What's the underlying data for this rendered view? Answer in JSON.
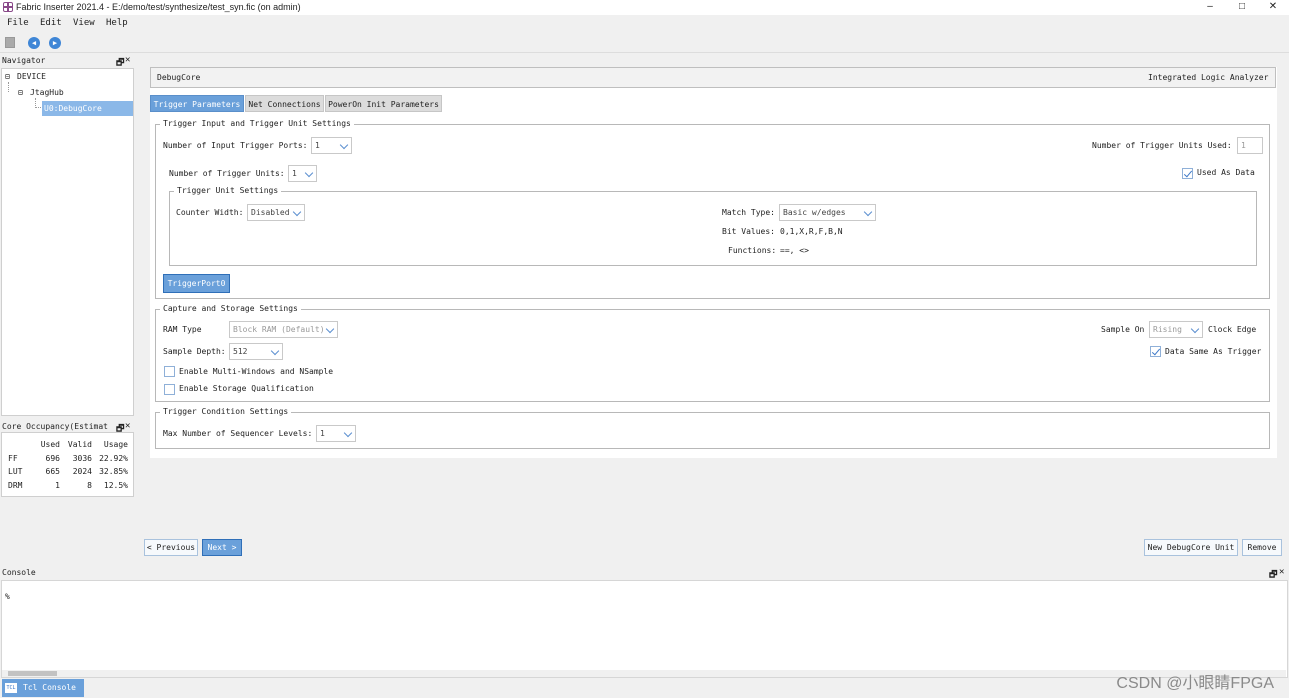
{
  "window": {
    "title": "Fabric Inserter 2021.4 - E:/demo/test/synthesize/test_syn.fic (on admin)",
    "minimize": "–",
    "maximize": "□",
    "close": "✕"
  },
  "menu": {
    "file": "File",
    "edit": "Edit",
    "view": "View",
    "help": "Help"
  },
  "toolbar": {
    "icons": [
      "save-icon",
      "back-icon",
      "forward-icon"
    ]
  },
  "navigator": {
    "title": "Navigator",
    "tree": [
      {
        "label": "DEVICE",
        "toggle": "⊟"
      },
      {
        "label": "JtagHub",
        "toggle": "⊟"
      },
      {
        "label": "U0:DebugCore",
        "selected": true
      }
    ]
  },
  "occupancy": {
    "title": "Core Occupancy(Estimat",
    "headers": [
      "",
      "Used",
      "Valid",
      "Usage"
    ],
    "rows": [
      [
        "FF",
        "696",
        "3036",
        "22.92%"
      ],
      [
        "LUT",
        "665",
        "2024",
        "32.85%"
      ],
      [
        "DRM",
        "1",
        "8",
        "12.5%"
      ]
    ]
  },
  "core_header": {
    "name": "DebugCore",
    "type": "Integrated Logic Analyzer"
  },
  "tabs": [
    "Trigger Parameters",
    "Net Connections",
    "PowerOn Init Parameters"
  ],
  "trigger_input": {
    "group": "Trigger Input and Trigger Unit Settings",
    "num_ports_label": "Number of Input Trigger Ports:",
    "num_ports": "1",
    "units_used_label": "Number of Trigger Units Used:",
    "units_used": "1",
    "num_units_label": "Number of Trigger Units:",
    "num_units": "1",
    "used_as_data": "Used As Data",
    "unit_group": "Trigger Unit Settings",
    "counter_width_label": "Counter Width:",
    "counter_width": "Disabled",
    "match_type_label": "Match Type:",
    "match_type": "Basic w/edges",
    "bit_values_label": "Bit Values:",
    "bit_values": "0,1,X,R,F,B,N",
    "functions_label": "Functions:",
    "functions": "==, <>",
    "port_button": "TriggerPort0"
  },
  "capture": {
    "group": "Capture and Storage Settings",
    "ram_type_label": "RAM Type",
    "ram_type": "Block RAM (Default)",
    "sample_on_label": "Sample On",
    "sample_on": "Rising",
    "clock_edge": "Clock Edge",
    "sample_depth_label": "Sample Depth:",
    "sample_depth": "512",
    "data_same": "Data Same As Trigger",
    "multi_windows": "Enable Multi-Windows and NSample",
    "storage_qual": "Enable Storage Qualification"
  },
  "condition": {
    "group": "Trigger Condition Settings",
    "max_levels_label": "Max Number of Sequencer Levels:",
    "max_levels": "1"
  },
  "buttons": {
    "previous": "< Previous",
    "next": "Next >",
    "new_unit": "New DebugCore Unit",
    "remove": "Remove"
  },
  "console": {
    "title": "Console",
    "prompt": "%",
    "tab": "Tcl Console",
    "tab_icon": "TCL"
  },
  "watermark": "CSDN @小眼睛FPGA",
  "colors": {
    "accent": "#6aa0da",
    "selection": "#8bb8e8"
  }
}
